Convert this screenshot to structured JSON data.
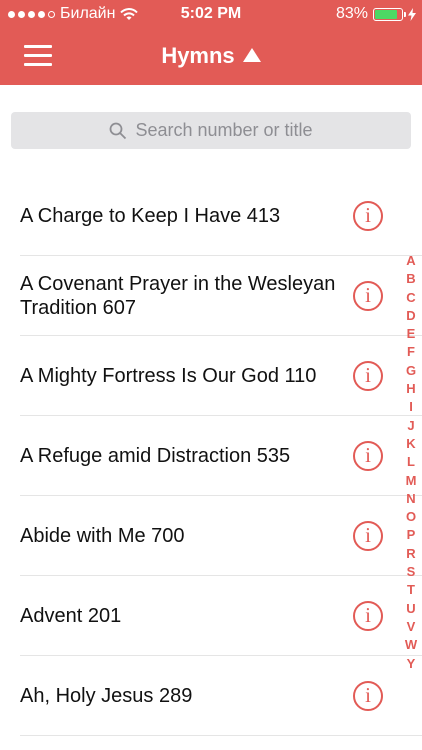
{
  "status_bar": {
    "carrier": "Билайн",
    "time": "5:02 PM",
    "battery_percent": "83%",
    "battery_level": 0.83,
    "signal_bars_filled": 4,
    "signal_bars_total": 5
  },
  "nav": {
    "title": "Hymns",
    "menu_icon": "hamburger-icon",
    "sort_icon": "triangle-up-icon"
  },
  "search": {
    "placeholder": "Search number or title"
  },
  "hymns": [
    {
      "title": "A Charge to Keep I Have 413"
    },
    {
      "title": "A Covenant Prayer in the Wesleyan Tradition 607"
    },
    {
      "title": "A Mighty Fortress Is Our God 110"
    },
    {
      "title": "A Refuge amid Distraction 535"
    },
    {
      "title": "Abide with Me 700"
    },
    {
      "title": "Advent 201"
    },
    {
      "title": "Ah, Holy Jesus 289"
    }
  ],
  "index_letters": [
    "A",
    "B",
    "C",
    "D",
    "E",
    "F",
    "G",
    "H",
    "I",
    "J",
    "K",
    "L",
    "M",
    "N",
    "O",
    "P",
    "R",
    "S",
    "T",
    "U",
    "V",
    "W",
    "Y"
  ],
  "colors": {
    "accent": "#e25b56",
    "battery": "#4cd964"
  }
}
